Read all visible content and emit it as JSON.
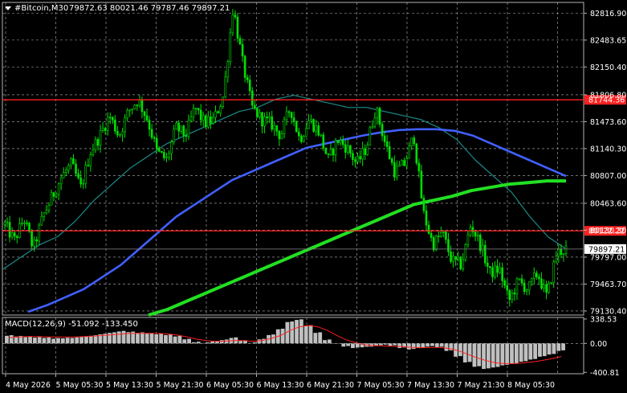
{
  "header": {
    "symbol": "#Bitcoin,M30",
    "ohlc": "79872.63 80021.46 79787.46 79897.21"
  },
  "macd_label": "MACD(12,26,9) -51.092 -133.450",
  "colors": {
    "background": "#000000",
    "grid": "#b4b4b4",
    "candle": "#00e000",
    "teal_ma": "#1a8c8c",
    "blue_ma": "#4060ff",
    "green_ma": "#22e022",
    "level_line": "#ff2020",
    "current_price_line": "#888888",
    "macd_hist": "#c0c0c0",
    "macd_signal": "#ff2020"
  },
  "chart_data": [
    {
      "type": "candlestick",
      "panel": "price",
      "y_ticks": [
        "82816.90",
        "82483.65",
        "82150.40",
        "81806.80",
        "81473.60",
        "81140.30",
        "80807.00",
        "80463.60",
        "80130.30",
        "79797.00",
        "79463.70",
        "79130.40"
      ],
      "x_ticks": [
        "4 May 2026",
        "5 May 05:30",
        "5 May 13:30",
        "5 May 21:30",
        "6 May 05:30",
        "6 May 13:30",
        "6 May 21:30",
        "7 May 05:30",
        "7 May 13:30",
        "7 May 21:30",
        "8 May 05:30"
      ],
      "ylim": [
        79080,
        82950
      ],
      "current_price": "79897.21",
      "price_levels": [
        {
          "value": "81744.36",
          "color": "#ff2020"
        },
        {
          "value": "80122.22",
          "color": "#ff2020"
        }
      ],
      "close_path": [
        80200,
        80000,
        80280,
        79900,
        80300,
        80550,
        80800,
        80950,
        80650,
        81100,
        81300,
        81550,
        81300,
        81600,
        81750,
        81500,
        81100,
        81000,
        81400,
        81300,
        81650,
        81450,
        81500,
        81800,
        82900,
        82200,
        81650,
        81500,
        81450,
        81300,
        81650,
        81250,
        81500,
        81350,
        81000,
        81250,
        81150,
        80950,
        81150,
        81650,
        81200,
        80850,
        80950,
        81300,
        80350,
        79950,
        80100,
        79750,
        79700,
        80200,
        79950,
        79600,
        79650,
        79250,
        79500,
        79400,
        79600,
        79300,
        79850,
        79900
      ],
      "moving_averages": [
        {
          "color": "teal",
          "values": [
            79650,
            79800,
            79950,
            80050,
            80250,
            80500,
            80700,
            80900,
            81050,
            81200,
            81300,
            81400,
            81500,
            81600,
            81650,
            81750,
            81800,
            81750,
            81700,
            81650,
            81650,
            81600,
            81550,
            81500,
            81400,
            81250,
            81000,
            80800,
            80600,
            80300,
            80050,
            79900
          ]
        },
        {
          "color": "blue",
          "values": [
            79120,
            79200,
            79300,
            79400,
            79550,
            79700,
            79900,
            80100,
            80300,
            80450,
            80600,
            80750,
            80850,
            80950,
            81050,
            81150,
            81200,
            81250,
            81300,
            81340,
            81370,
            81380,
            81380,
            81360,
            81300,
            81200,
            81100,
            81000,
            80900,
            80800
          ]
        },
        {
          "color": "green",
          "values": [
            79080,
            79150,
            79250,
            79350,
            79450,
            79550,
            79650,
            79750,
            79850,
            79950,
            80050,
            80150,
            80250,
            80350,
            80450,
            80500,
            80550,
            80620,
            80660,
            80700,
            80720,
            80740,
            80740
          ]
        }
      ]
    },
    {
      "type": "bar",
      "panel": "macd",
      "y_ticks": [
        "338.53",
        "0.00",
        "-400.81"
      ],
      "ylim": [
        -420,
        360
      ],
      "histogram": [
        110,
        100,
        90,
        85,
        80,
        70,
        75,
        80,
        95,
        110,
        130,
        150,
        170,
        160,
        150,
        140,
        130,
        120,
        100,
        60,
        20,
        10,
        30,
        50,
        80,
        40,
        10,
        60,
        120,
        200,
        300,
        330,
        250,
        150,
        50,
        0,
        -40,
        -60,
        -50,
        -40,
        -20,
        -30,
        -60,
        -80,
        -60,
        -40,
        -50,
        -100,
        -180,
        -260,
        -320,
        -350,
        -330,
        -300,
        -280,
        -250,
        -220,
        -180,
        -150,
        -100
      ],
      "signal": [
        80,
        90,
        95,
        95,
        90,
        90,
        88,
        90,
        95,
        100,
        110,
        120,
        130,
        138,
        140,
        140,
        138,
        130,
        115,
        90,
        60,
        40,
        30,
        30,
        40,
        40,
        30,
        40,
        70,
        110,
        180,
        230,
        250,
        230,
        180,
        110,
        50,
        10,
        -20,
        -30,
        -35,
        -40,
        -45,
        -55,
        -60,
        -55,
        -55,
        -70,
        -100,
        -150,
        -200,
        -240,
        -270,
        -280,
        -280,
        -270,
        -255,
        -235,
        -210,
        -180
      ]
    }
  ]
}
